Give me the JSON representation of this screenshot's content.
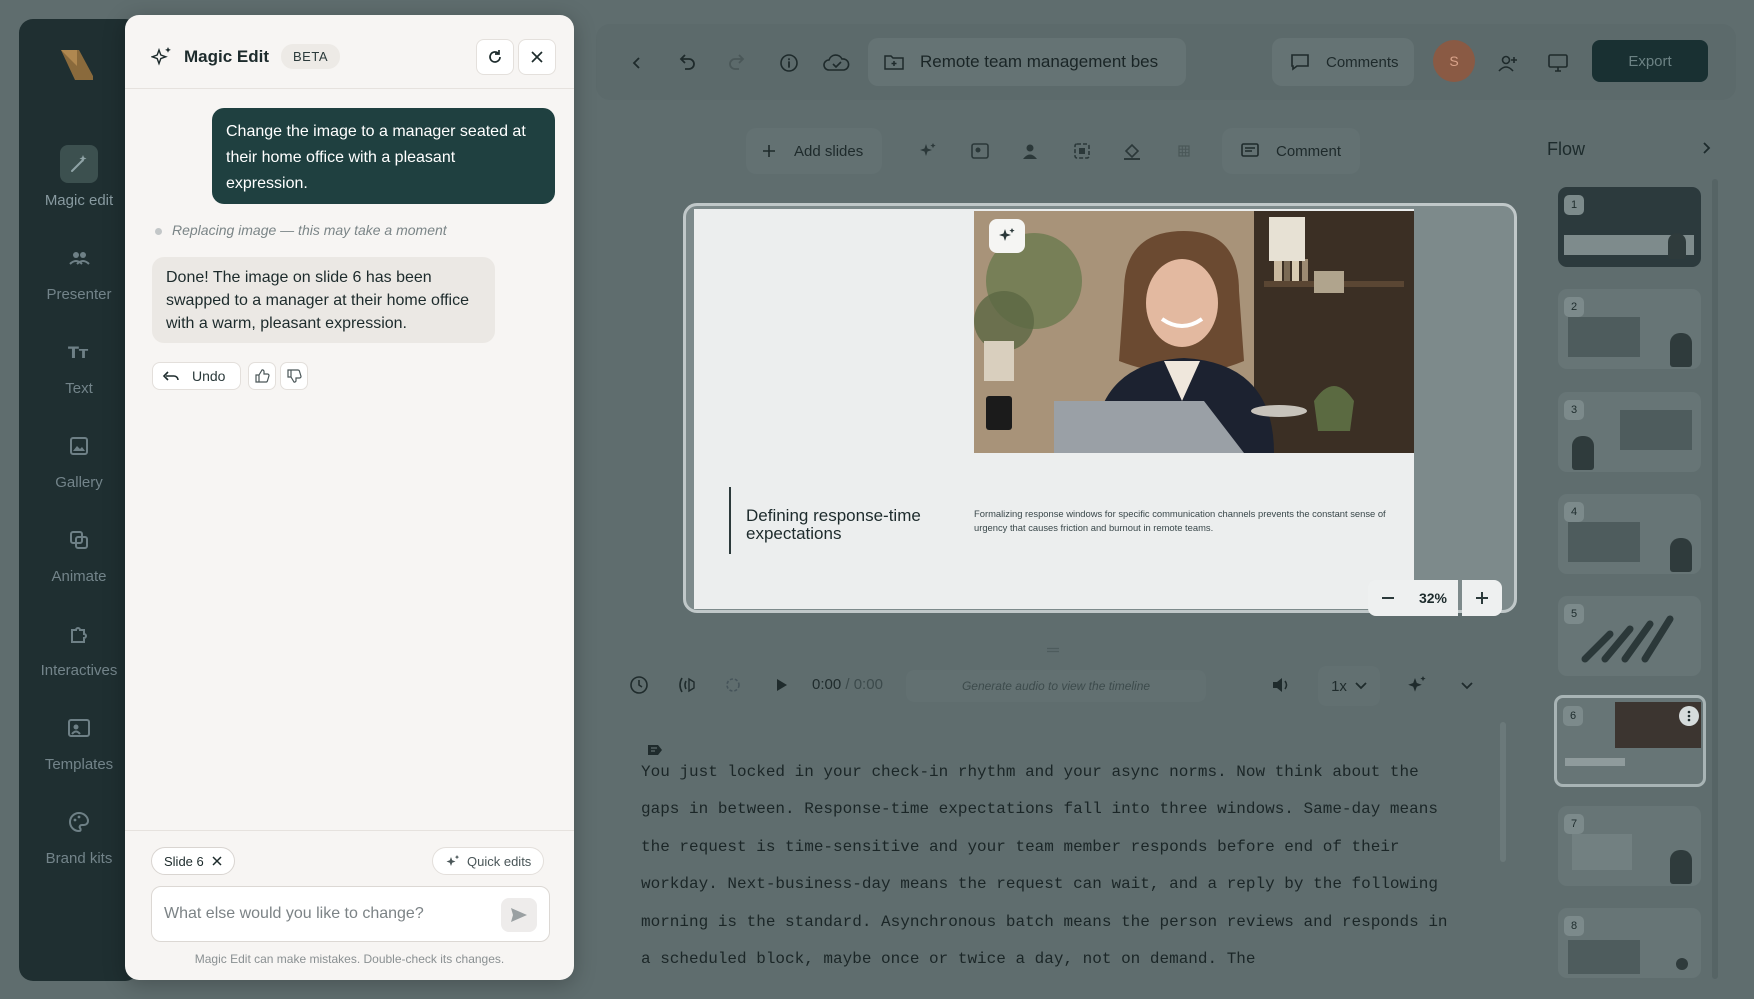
{
  "rail": {
    "items": [
      {
        "label": "Magic edit",
        "icon": "magic-wand-icon",
        "active": true
      },
      {
        "label": "Presenter",
        "icon": "people-icon",
        "active": false
      },
      {
        "label": "Text",
        "icon": "text-icon",
        "active": false
      },
      {
        "label": "Gallery",
        "icon": "image-icon",
        "active": false
      },
      {
        "label": "Animate",
        "icon": "layers-icon",
        "active": false
      },
      {
        "label": "Interactives",
        "icon": "puzzle-icon",
        "active": false
      },
      {
        "label": "Templates",
        "icon": "template-icon",
        "active": false
      },
      {
        "label": "Brand kits",
        "icon": "palette-icon",
        "active": false
      }
    ]
  },
  "magic_edit": {
    "title": "Magic Edit",
    "badge": "BETA",
    "user_message": "Change the image to a manager seated at their home office with a pleasant expression.",
    "status": "Replacing image — this may take a moment",
    "reply": "Done! The image on slide 6 has been swapped to a manager at their home office with a warm, pleasant expression.",
    "undo_label": "Undo",
    "context_chip": "Slide 6",
    "quick_edits_label": "Quick edits",
    "input_placeholder": "What else would you like to change?",
    "disclaimer": "Magic Edit can make mistakes. Double-check its changes."
  },
  "topbar": {
    "doc_title": "Remote team management bes",
    "comments_label": "Comments",
    "avatar_initial": "S",
    "export_label": "Export"
  },
  "slide_tools": {
    "add_slides_label": "Add slides",
    "comment_label": "Comment"
  },
  "slide": {
    "heading": "Defining response-time expectations",
    "body": "Formalizing response windows for specific communication channels prevents the constant sense of urgency that causes friction and burnout in remote teams.",
    "zoom": "32%"
  },
  "audio": {
    "current_time": "0:00",
    "separator": "/",
    "total_time": "0:00",
    "timeline_hint": "Generate audio to view the timeline",
    "speed": "1x"
  },
  "script": {
    "text": "You just locked in your check-in rhythm and your async norms. Now think about the gaps in between. Response-time expectations fall into three windows. Same-day means the request is time-sensitive and your team member responds before end of their workday. Next-business-day means the request can wait, and a reply by the following morning is the standard. Asynchronous batch means the person reviews and responds in a scheduled block, maybe once or twice a day, not on demand. The"
  },
  "flow": {
    "title": "Flow",
    "slides": [
      "1",
      "2",
      "3",
      "4",
      "5",
      "6",
      "7",
      "8"
    ],
    "active_slide": "6"
  },
  "colors": {
    "accent_dark": "#1f4040",
    "rail_bg": "#1f2f31",
    "overlay": "#5f6d6e"
  }
}
